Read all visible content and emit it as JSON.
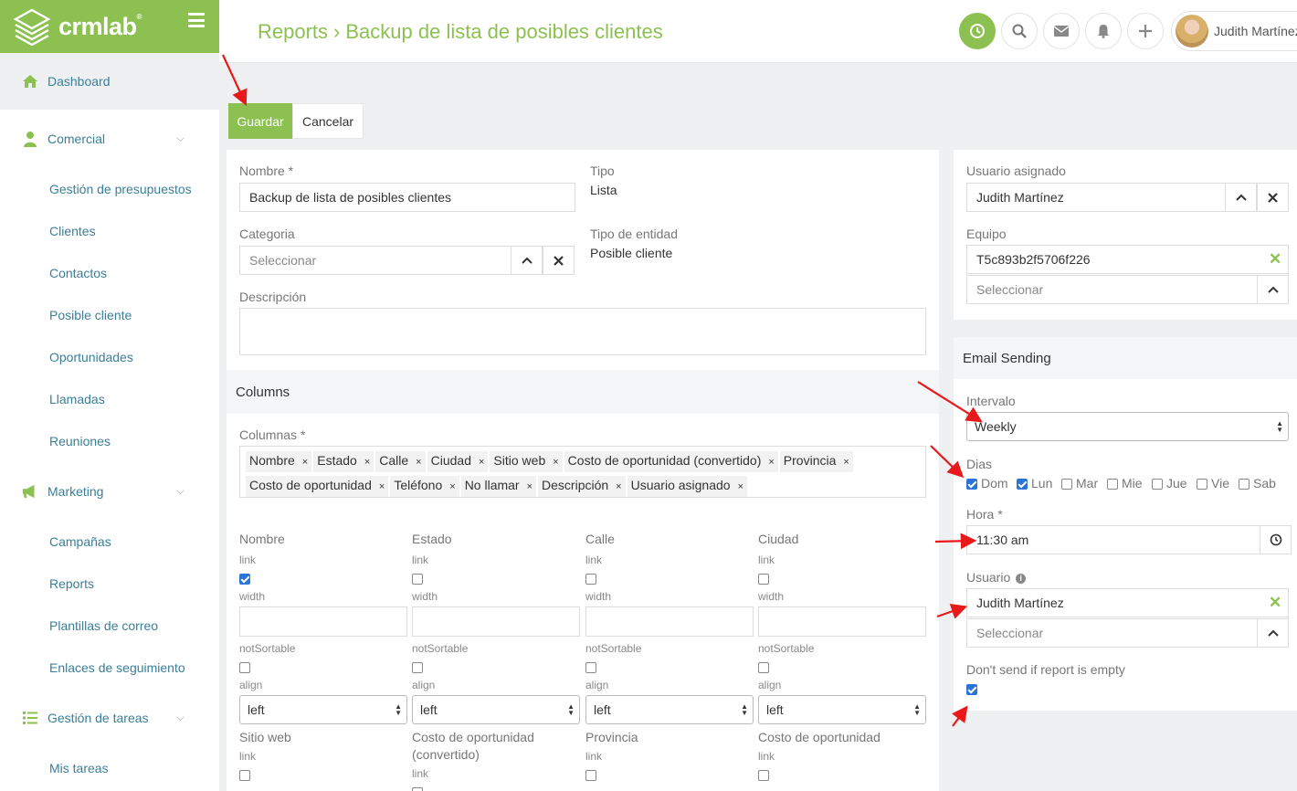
{
  "logo": {
    "text": "crmlab",
    "reg": "®"
  },
  "sidebar": {
    "dashboard": "Dashboard",
    "comercial": "Comercial",
    "comercial_items": [
      "Gestión de presupuestos",
      "Clientes",
      "Contactos",
      "Posible cliente",
      "Oportunidades",
      "Llamadas",
      "Reuniones"
    ],
    "marketing": "Marketing",
    "marketing_items": [
      "Campañas",
      "Reports",
      "Plantillas de correo",
      "Enlaces de seguimiento"
    ],
    "tareas": "Gestión de tareas",
    "tareas_items": [
      "Mis tareas"
    ]
  },
  "header": {
    "crumb_parent": "Reports",
    "crumb_sep": "›",
    "crumb_current": "Backup de lista de posibles clientes",
    "user": "Judith Martínez"
  },
  "toolbar": {
    "save": "Guardar",
    "cancel": "Cancelar"
  },
  "form": {
    "nombre_label": "Nombre *",
    "nombre_value": "Backup de lista de posibles clientes",
    "tipo_label": "Tipo",
    "tipo_value": "Lista",
    "categoria_label": "Categoria",
    "categoria_placeholder": "Seleccionar",
    "entidad_label": "Tipo de entidad",
    "entidad_value": "Posible cliente",
    "descripcion_label": "Descripción"
  },
  "columns_section": {
    "title": "Columns",
    "columnas_label": "Columnas *",
    "tags_row1": [
      "Nombre",
      "Estado",
      "Calle",
      "Ciudad",
      "Sitio web",
      "Costo de oportunidad (convertido)",
      "Provincia"
    ],
    "tags_row2": [
      "Costo de oportunidad",
      "Teléfono",
      "No llamar",
      "Descripción",
      "Usuario asignado"
    ],
    "remove": "×",
    "col_names": [
      "Nombre",
      "Estado",
      "Calle",
      "Ciudad"
    ],
    "col_names_next": [
      "Sitio web",
      "Costo de oportunidad (convertido)",
      "Provincia",
      "Costo de oportunidad"
    ],
    "link_label": "link",
    "width_label": "width",
    "notsortable_label": "notSortable",
    "align_label": "align",
    "align_value": "left",
    "link_checked": [
      true,
      false,
      false,
      false
    ]
  },
  "right": {
    "usuario_asignado_label": "Usuario asignado",
    "usuario_asignado_value": "Judith Martínez",
    "equipo_label": "Equipo",
    "equipo_value": "T5c893b2f5706f226",
    "equipo_placeholder": "Seleccionar"
  },
  "email": {
    "title": "Email Sending",
    "intervalo_label": "Intervalo",
    "intervalo_value": "Weekly",
    "dias_label": "Dias",
    "days": [
      {
        "name": "Dom",
        "checked": true
      },
      {
        "name": "Lun",
        "checked": true
      },
      {
        "name": "Mar",
        "checked": false
      },
      {
        "name": "Mie",
        "checked": false
      },
      {
        "name": "Jue",
        "checked": false
      },
      {
        "name": "Vie",
        "checked": false
      },
      {
        "name": "Sab",
        "checked": false
      }
    ],
    "hora_label": "Hora *",
    "hora_value": "11:30 am",
    "usuario_label": "Usuario",
    "usuario_value": "Judith Martínez",
    "usuario_placeholder": "Seleccionar",
    "empty_label": "Don't send if report is empty",
    "empty_checked": true
  },
  "colors": {
    "brand": "#8cc152",
    "link": "#3a7f99",
    "annotation": "#e8191b"
  }
}
